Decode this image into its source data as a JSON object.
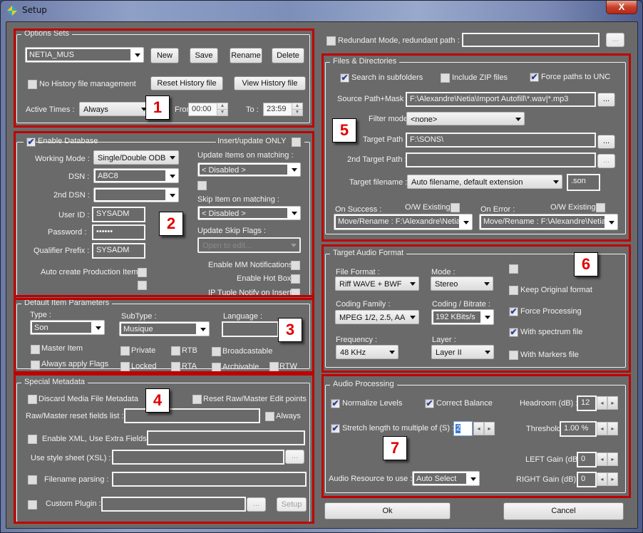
{
  "window": {
    "title": "Setup",
    "close_label": "X"
  },
  "badges": [
    "1",
    "2",
    "3",
    "4",
    "5",
    "6",
    "7"
  ],
  "options_sets": {
    "title": "Options Sets",
    "selected_set": "NETIA_MUS",
    "buttons": {
      "new": "New",
      "save": "Save",
      "rename": "Rename",
      "delete": "Delete"
    },
    "no_history_label": "No History file management",
    "no_history_checked": false,
    "reset_history": "Reset History file",
    "view_history": "View History file",
    "active_times_label": "Active Times :",
    "active_times_value": "Always",
    "from_label": "From :",
    "from_value": "00:00",
    "to_label": "To :",
    "to_value": "23:59"
  },
  "database": {
    "enable_label": "Enable Database",
    "enable_checked": true,
    "insert_update_label": "Insert/update ONLY",
    "insert_update_checked": false,
    "working_mode_label": "Working Mode :",
    "working_mode_value": "Single/Double ODBC",
    "dsn_label": "DSN :",
    "dsn_value": "ABC8",
    "dsn2_label": "2nd DSN :",
    "dsn2_value": "",
    "user_id_label": "User ID :",
    "user_id_value": "SYSADM",
    "password_label": "Password :",
    "password_value": "••••••",
    "qualifier_label": "Qualifier Prefix :",
    "qualifier_value": "SYSADM",
    "auto_create_label": "Auto create Production Item",
    "update_items_label": "Update Items on matching :",
    "update_items_value": "< Disabled >",
    "skip_item_label": "Skip Item on matching :",
    "skip_item_value": "< Disabled >",
    "update_skip_label": "Update Skip Flags :",
    "update_skip_placeholder": "Open to edit...",
    "mm_notifications_label": "Enable MM Notifications",
    "hot_box_label": "Enable Hot Box",
    "ip_tuple_label": "IP Tuple Notify on Insert"
  },
  "default_item": {
    "title": "Default Item Parameters",
    "type_label": "Type :",
    "type_value": "Son",
    "subtype_label": "SubType :",
    "subtype_value": "Musique",
    "language_label": "Language :",
    "language_value": "",
    "flags": {
      "master_item": "Master Item",
      "always_apply": "Always apply Flags",
      "private": "Private",
      "locked": "Locked",
      "rtb": "RTB",
      "rta": "RTA",
      "broadcastable": "Broadcastable",
      "archivable": "Archivable",
      "rtw": "RTW"
    }
  },
  "special_metadata": {
    "title": "Special Metadata",
    "discard_label": "Discard Media File Metadata",
    "reset_raw_label": "Reset Raw/Master Edit points",
    "reset_fields_label": "Raw/Master reset fields list :",
    "reset_fields_value": "",
    "always_label": "Always",
    "enable_xml_label": "Enable XML, Use Extra Fields :",
    "xsl_label": "Use style sheet (XSL) :",
    "filename_parsing_label": "Filename parsing :",
    "custom_plugin_label": "Custom Plugin :",
    "browse_label": "...",
    "setup_label": "Setup"
  },
  "redundant": {
    "label": "Redundant Mode, redundant path :",
    "value": "",
    "browse": "..."
  },
  "files": {
    "title": "Files & Directories",
    "search_subfolders": "Search in subfolders",
    "search_subfolders_checked": true,
    "include_zip": "Include ZIP files",
    "include_zip_checked": false,
    "force_unc": "Force paths to UNC",
    "force_unc_checked": true,
    "source_label": "Source Path+Mask :",
    "source_value": "F:\\Alexandre\\Netia\\Import Autofill\\*.wav|*.mp3",
    "filter_label": "Filter mode :",
    "filter_value": "<none>",
    "target_label": "Target Path :",
    "target_value": "F:\\SONS\\",
    "target2_label": "2nd Target Path :",
    "target2_value": "",
    "target_filename_label": "Target filename :",
    "target_filename_value": "Auto filename, default extension",
    "extension_value": ".son",
    "on_success_label": "On Success :",
    "on_error_label": "On Error :",
    "ow_existing_label": "O/W Existing",
    "on_success_value": "Move/Rename : F:\\Alexandre\\Netia\\",
    "on_error_value": "Move/Rename : F:\\Alexandre\\Netia\\",
    "browse": "..."
  },
  "audio_format": {
    "title": "Target Audio Format",
    "file_format_label": "File Format :",
    "file_format_value": "Riff WAVE + BWF",
    "mode_label": "Mode :",
    "mode_value": "Stereo",
    "coding_family_label": "Coding Family :",
    "coding_family_value": "MPEG 1/2, 2.5, AAC",
    "bitrate_label": "Coding / Bitrate :",
    "bitrate_value": "192 KBits/s",
    "frequency_label": "Frequency :",
    "frequency_value": "48 KHz",
    "layer_label": "Layer :",
    "layer_value": "Layer II",
    "keep_original": "Keep Original format",
    "keep_original_checked": false,
    "force_processing": "Force Processing",
    "force_processing_checked": true,
    "with_spectrum": "With spectrum file",
    "with_spectrum_checked": true,
    "with_markers": "With Markers file",
    "with_markers_checked": false
  },
  "audio_processing": {
    "title": "Audio Processing",
    "normalize": "Normalize Levels",
    "normalize_checked": true,
    "correct_balance": "Correct Balance",
    "correct_balance_checked": true,
    "stretch": "Stretch length to multiple of (S) :",
    "stretch_checked": true,
    "stretch_value": "2",
    "headroom_label": "Headroom (dB) :",
    "headroom_value": "12",
    "threshold_label": "Threshold :",
    "threshold_value": "1.00 %",
    "left_gain_label": "LEFT Gain (dB) :",
    "left_gain_value": "0",
    "right_gain_label": "RIGHT Gain (dB) :",
    "right_gain_value": "0",
    "resource_label": "Audio Resource to use :",
    "resource_value": "Auto Select"
  },
  "footer": {
    "ok": "Ok",
    "cancel": "Cancel"
  }
}
